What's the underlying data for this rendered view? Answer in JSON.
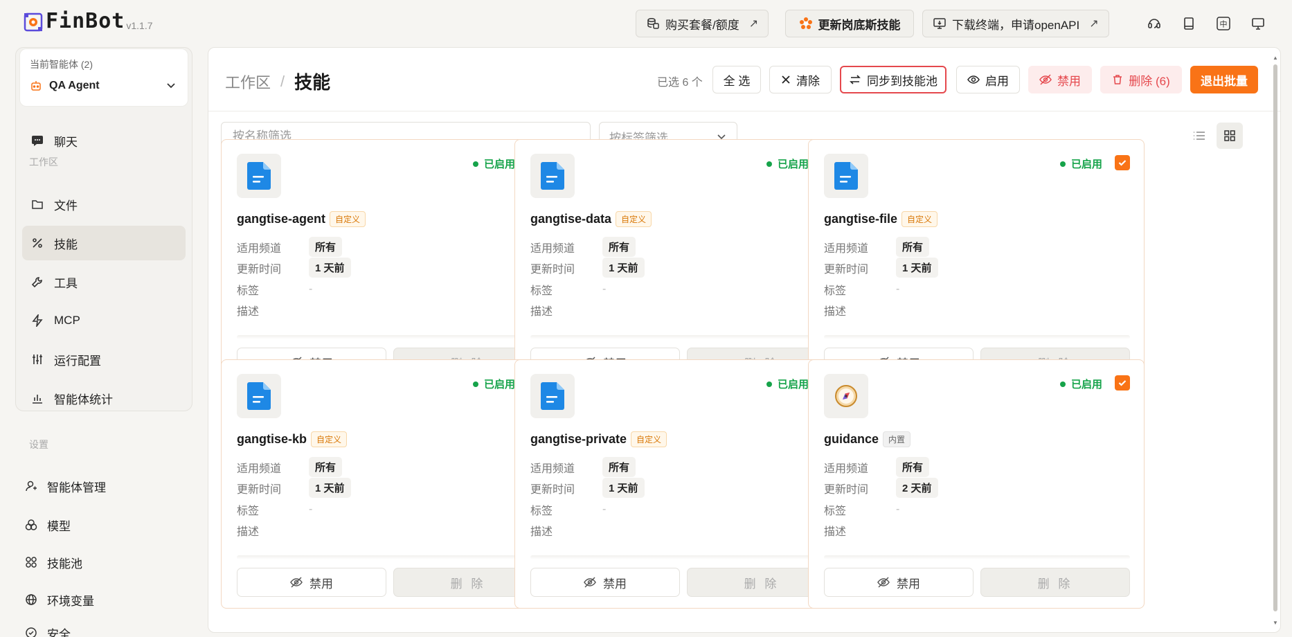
{
  "app": {
    "name": "FinBot",
    "version": "v1.1.7"
  },
  "topbar": {
    "buy_label": "购买套餐/额度",
    "update_label": "更新岗底斯技能",
    "download_label": "下载终端，申请openAPI",
    "arrow": "↗",
    "icons": [
      "support-icon",
      "book-icon",
      "language-icon",
      "monitor-icon"
    ]
  },
  "sidebar": {
    "current_agent_caption": "当前智能体 (2)",
    "current_agent_name": "QA Agent",
    "chat_label": "聊天",
    "workspace_section": "工作区",
    "workspace_items": [
      {
        "label": "文件",
        "icon": "folder-icon"
      },
      {
        "label": "技能",
        "icon": "skill-icon",
        "active": true
      },
      {
        "label": "工具",
        "icon": "wrench-icon"
      },
      {
        "label": "MCP",
        "icon": "bolt-icon"
      },
      {
        "label": "运行配置",
        "icon": "sliders-icon"
      },
      {
        "label": "智能体统计",
        "icon": "bar-chart-icon"
      }
    ],
    "settings_section": "设置",
    "settings_items": [
      {
        "label": "智能体管理",
        "icon": "user-manage-icon"
      },
      {
        "label": "模型",
        "icon": "model-icon"
      },
      {
        "label": "技能池",
        "icon": "grid-pool-icon"
      },
      {
        "label": "环境变量",
        "icon": "globe-icon"
      },
      {
        "label": "安全",
        "icon": "shield-icon"
      }
    ]
  },
  "header": {
    "breadcrumb_root": "工作区",
    "breadcrumb_sep": "/",
    "breadcrumb_current": "技能",
    "selected_info": "已选 6 个",
    "select_all": "全 选",
    "clear": "清除",
    "sync": "同步到技能池",
    "enable": "启用",
    "disable": "禁用",
    "delete": "删除 (6)",
    "exit_batch": "退出批量"
  },
  "filters": {
    "name_placeholder": "按名称筛选",
    "tag_placeholder": "按标签筛选"
  },
  "labels": {
    "channel": "适用频道",
    "updated": "更新时间",
    "tags": "标签",
    "desc": "描述",
    "disable_btn": "禁用",
    "delete_btn": "删 除",
    "status": "已启用"
  },
  "skills": [
    {
      "name": "gangtise-agent",
      "tag": "自定义",
      "kind": "custom",
      "channel": "所有",
      "updated": "1 天前",
      "tags": "-",
      "icon": "document-icon"
    },
    {
      "name": "gangtise-data",
      "tag": "自定义",
      "kind": "custom",
      "channel": "所有",
      "updated": "1 天前",
      "tags": "-",
      "icon": "document-icon"
    },
    {
      "name": "gangtise-file",
      "tag": "自定义",
      "kind": "custom",
      "channel": "所有",
      "updated": "1 天前",
      "tags": "-",
      "icon": "document-icon"
    },
    {
      "name": "gangtise-kb",
      "tag": "自定义",
      "kind": "custom",
      "channel": "所有",
      "updated": "1 天前",
      "tags": "-",
      "icon": "document-icon"
    },
    {
      "name": "gangtise-private",
      "tag": "自定义",
      "kind": "custom",
      "channel": "所有",
      "updated": "1 天前",
      "tags": "-",
      "icon": "document-icon"
    },
    {
      "name": "guidance",
      "tag": "内置",
      "kind": "builtin",
      "channel": "所有",
      "updated": "2 天前",
      "tags": "-",
      "icon": "compass-icon"
    }
  ],
  "colors": {
    "accent": "#f97316",
    "enabled": "#16a34a",
    "danger": "#e5484d",
    "doc_blue": "#1e88e5"
  }
}
